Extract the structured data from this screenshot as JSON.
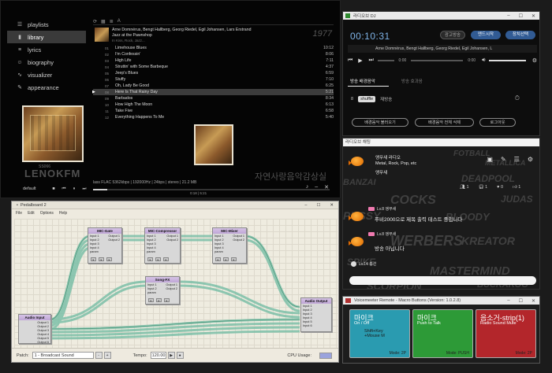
{
  "lms": {
    "nav": [
      {
        "icon": "playlist-icon",
        "glyph": "☰",
        "label": "playlists",
        "active": false
      },
      {
        "icon": "library-icon",
        "glyph": "▮",
        "label": "library",
        "active": true
      },
      {
        "icon": "lyrics-icon",
        "glyph": "≡",
        "label": "lyrics",
        "active": false
      },
      {
        "icon": "biography-icon",
        "glyph": "☺",
        "label": "biography",
        "active": false
      },
      {
        "icon": "visualizer-icon",
        "glyph": "∿",
        "label": "visualizer",
        "active": false
      },
      {
        "icon": "appearance-icon",
        "glyph": "✎",
        "label": "appearance",
        "active": false
      }
    ],
    "tracklist_header": "A",
    "album_artists": "Arne Domnérus, Bengt Hallberg, Georg Riedel, Egil Johansen, Lars Erstrand",
    "album_title": "Jazz at the Pawnshop",
    "album_sub": "In Kiss, Rock, Jazz...",
    "album_year": "1977",
    "tracks": [
      {
        "n": "01",
        "title": "Limehouse Blues",
        "dur": "10:12",
        "playing": false
      },
      {
        "n": "02",
        "title": "I'm Confessin'",
        "dur": "8:06",
        "playing": false
      },
      {
        "n": "03",
        "title": "High Life",
        "dur": "7:11",
        "playing": false
      },
      {
        "n": "04",
        "title": "Struttin' with Some Barbeque",
        "dur": "4:37",
        "playing": false
      },
      {
        "n": "05",
        "title": "Jeep's Blues",
        "dur": "6:59",
        "playing": false
      },
      {
        "n": "06",
        "title": "Stuffy",
        "dur": "7:10",
        "playing": false
      },
      {
        "n": "07",
        "title": "Oh, Lady Be Good",
        "dur": "6:25",
        "playing": false
      },
      {
        "n": "08",
        "title": "Here Is That Rainy Day",
        "dur": "5:21",
        "playing": true
      },
      {
        "n": "09",
        "title": "Barbados",
        "dur": "8:34",
        "playing": false
      },
      {
        "n": "10",
        "title": "How High The Moon",
        "dur": "6:13",
        "playing": false
      },
      {
        "n": "11",
        "title": "Take Five",
        "dur": "6:58",
        "playing": false
      },
      {
        "n": "12",
        "title": "Everything Happens To Me",
        "dur": "5:40",
        "playing": false
      }
    ],
    "cover_caption": "SS066",
    "watermark_left": "LENOKFM",
    "watermark_right": "자연사랑음악감상실",
    "format": "lass FLAC 5362kbps | 192000Hz | 24bps | stereo | 21.2 MB",
    "player_label": "default",
    "time": "0:18 | 5:21",
    "progress": 0.06
  },
  "pedalboard": {
    "title": "Pedalboard 2",
    "menu": [
      "File",
      "Edit",
      "Options",
      "Help"
    ],
    "nodes": [
      {
        "name": "Audio Input",
        "ins": [],
        "outs": [
          "Output 1",
          "Output 2",
          "Output 3",
          "Output 4",
          "Output 5",
          "Output 6"
        ]
      },
      {
        "name": "MIC-Gate",
        "ins": [
          "Input 1",
          "Input 2",
          "Input 3",
          "Input 4",
          "param"
        ],
        "outs": [
          "Output 1",
          "Output 2"
        ]
      },
      {
        "name": "MIC-Compressor",
        "ins": [
          "Input 1",
          "Input 2",
          "Input 3",
          "Input 4",
          "param"
        ],
        "outs": [
          "Output 1",
          "Output 2"
        ]
      },
      {
        "name": "MIC-Mixer",
        "ins": [
          "Input 1",
          "Input 2",
          "Input 3",
          "Input 4",
          "param"
        ],
        "outs": [
          "Output 1",
          "Output 2"
        ]
      },
      {
        "name": "Song-FX",
        "ins": [
          "Input 1",
          "Input 2",
          "param"
        ],
        "outs": [
          "Output 1",
          "Output 2"
        ]
      },
      {
        "name": "Audio Output",
        "ins": [
          "Input 1",
          "Input 2",
          "Input 3",
          "Input 4",
          "Input 5",
          "Input 6"
        ],
        "outs": []
      }
    ],
    "patch_label": "Patch:",
    "patch_value": "1 - Broadcast Sound",
    "tempo_label": "Tempo:",
    "tempo_value": "120.00",
    "cpu_label": "CPU Usage:"
  },
  "radio": {
    "title": "라디오브 DJ",
    "clock": "00:10:31",
    "buttons": [
      "광고방송",
      "엔드시작",
      "장치선택"
    ],
    "now_playing": "Arne Domnérus, Bengt Hallberg, Georg Riedel, Egil Johansen, L",
    "play_time": "0:00",
    "vol_time": "0:00",
    "tab_active": "방송 배경음악",
    "tab_other": "방송 효과음",
    "shuffle_num": "8",
    "shuffle_label": "shuffle",
    "shuffle_text": "재방송",
    "bottom_buttons": [
      "배경음악 불러오기",
      "배경음악 전체 삭제",
      "로그아웃"
    ]
  },
  "chat": {
    "header": "라디오브 채팅",
    "profile_name": "앵무새 라디오",
    "profile_genres": "Metal, Rock, Pop, etc",
    "profile_name2": "앵무새",
    "stats": [
      "1",
      "1",
      "0",
      "1"
    ],
    "messages": [
      {
        "level": "Lv.8 앵무새",
        "text": "푸비2000으로 제목 출력 테스트 중입니다"
      },
      {
        "level": "Lv.8 앵무새",
        "text": "방송 아닙니다"
      }
    ],
    "last_user": "Lv.14 총선",
    "bg_words": [
      "FOTBALL",
      "METALLICA",
      "DEADPOOL",
      "COCKS",
      "PUSSY",
      "BLOODY",
      "WERBERS",
      "KREATOR",
      "SPIKE",
      "MASTERMIND",
      "BUCKAROO",
      "SCORPION",
      "JUDAS",
      "BANZAI"
    ]
  },
  "voicemeeter": {
    "title": "Voicemeeter Remote - Macro Buttons (Version: 1.0.2.8)",
    "buttons": [
      {
        "l1": "마이크",
        "l2": "On / Off",
        "l3": "Shift+Key\n+Mouse M",
        "mode": "Mode: 2P",
        "color": "#2a9bb0"
      },
      {
        "l1": "마이크",
        "l2": "Push to Talk",
        "l3": "",
        "mode": "Mode: PUSH",
        "color": "#2d9a37"
      },
      {
        "l1": "음소거-strip(1)",
        "l2": "Radio Sound Mute",
        "l3": "",
        "mode": "Mode: 2P",
        "color": "#b3262b"
      }
    ]
  }
}
